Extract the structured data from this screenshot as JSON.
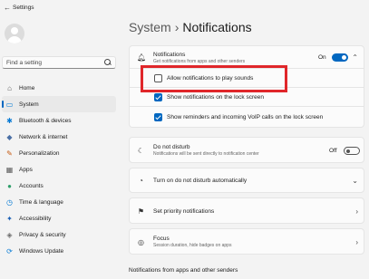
{
  "window": {
    "title": "Settings",
    "back_glyph": "←"
  },
  "sidebar": {
    "search_placeholder": "Find a setting",
    "items": [
      {
        "label": "Home",
        "icon": "home-icon",
        "glyph": "⌂",
        "color": "#555555"
      },
      {
        "label": "System",
        "icon": "monitor-icon",
        "glyph": "▭",
        "color": "#0078d4",
        "active": true
      },
      {
        "label": "Bluetooth & devices",
        "icon": "bluetooth-icon",
        "glyph": "✱",
        "color": "#0078d4"
      },
      {
        "label": "Network & internet",
        "icon": "wifi-icon",
        "glyph": "◆",
        "color": "#4a6fa5"
      },
      {
        "label": "Personalization",
        "icon": "brush-icon",
        "glyph": "✎",
        "color": "#c55a11"
      },
      {
        "label": "Apps",
        "icon": "apps-icon",
        "glyph": "▦",
        "color": "#5a5a5a"
      },
      {
        "label": "Accounts",
        "icon": "account-icon",
        "glyph": "●",
        "color": "#2e9e6a"
      },
      {
        "label": "Time & language",
        "icon": "globe-clock-icon",
        "glyph": "◷",
        "color": "#0078d4"
      },
      {
        "label": "Accessibility",
        "icon": "accessibility-icon",
        "glyph": "✦",
        "color": "#1a5fb4"
      },
      {
        "label": "Privacy & security",
        "icon": "shield-icon",
        "glyph": "◈",
        "color": "#6b6b6b"
      },
      {
        "label": "Windows Update",
        "icon": "update-icon",
        "glyph": "⟳",
        "color": "#0078d4"
      }
    ]
  },
  "header": {
    "crumb": "System",
    "separator": "›",
    "title": "Notifications"
  },
  "notifications": {
    "title": "Notifications",
    "subtitle": "Get notifications from apps and other senders",
    "toggle_label": "On",
    "toggle_on": true,
    "chevron": "⌃"
  },
  "options": [
    {
      "label": "Allow notifications to play sounds",
      "checked": false
    },
    {
      "label": "Show notifications on the lock screen",
      "checked": true
    },
    {
      "label": "Show reminders and incoming VoIP calls on the lock screen",
      "checked": true
    }
  ],
  "dnd": {
    "title": "Do not disturb",
    "subtitle": "Notifications will be sent directly to notification center",
    "toggle_label": "Off",
    "toggle_on": false
  },
  "auto_dnd": {
    "title": "Turn on do not disturb automatically",
    "chevron": "⌄"
  },
  "priority": {
    "title": "Set priority notifications",
    "chevron": "›"
  },
  "focus": {
    "title": "Focus",
    "subtitle": "Session duration, hide badges on apps",
    "chevron": "›"
  },
  "section_heading": "Notifications from apps and other senders",
  "colors": {
    "accent": "#0067c0",
    "highlight": "#e0262a"
  }
}
